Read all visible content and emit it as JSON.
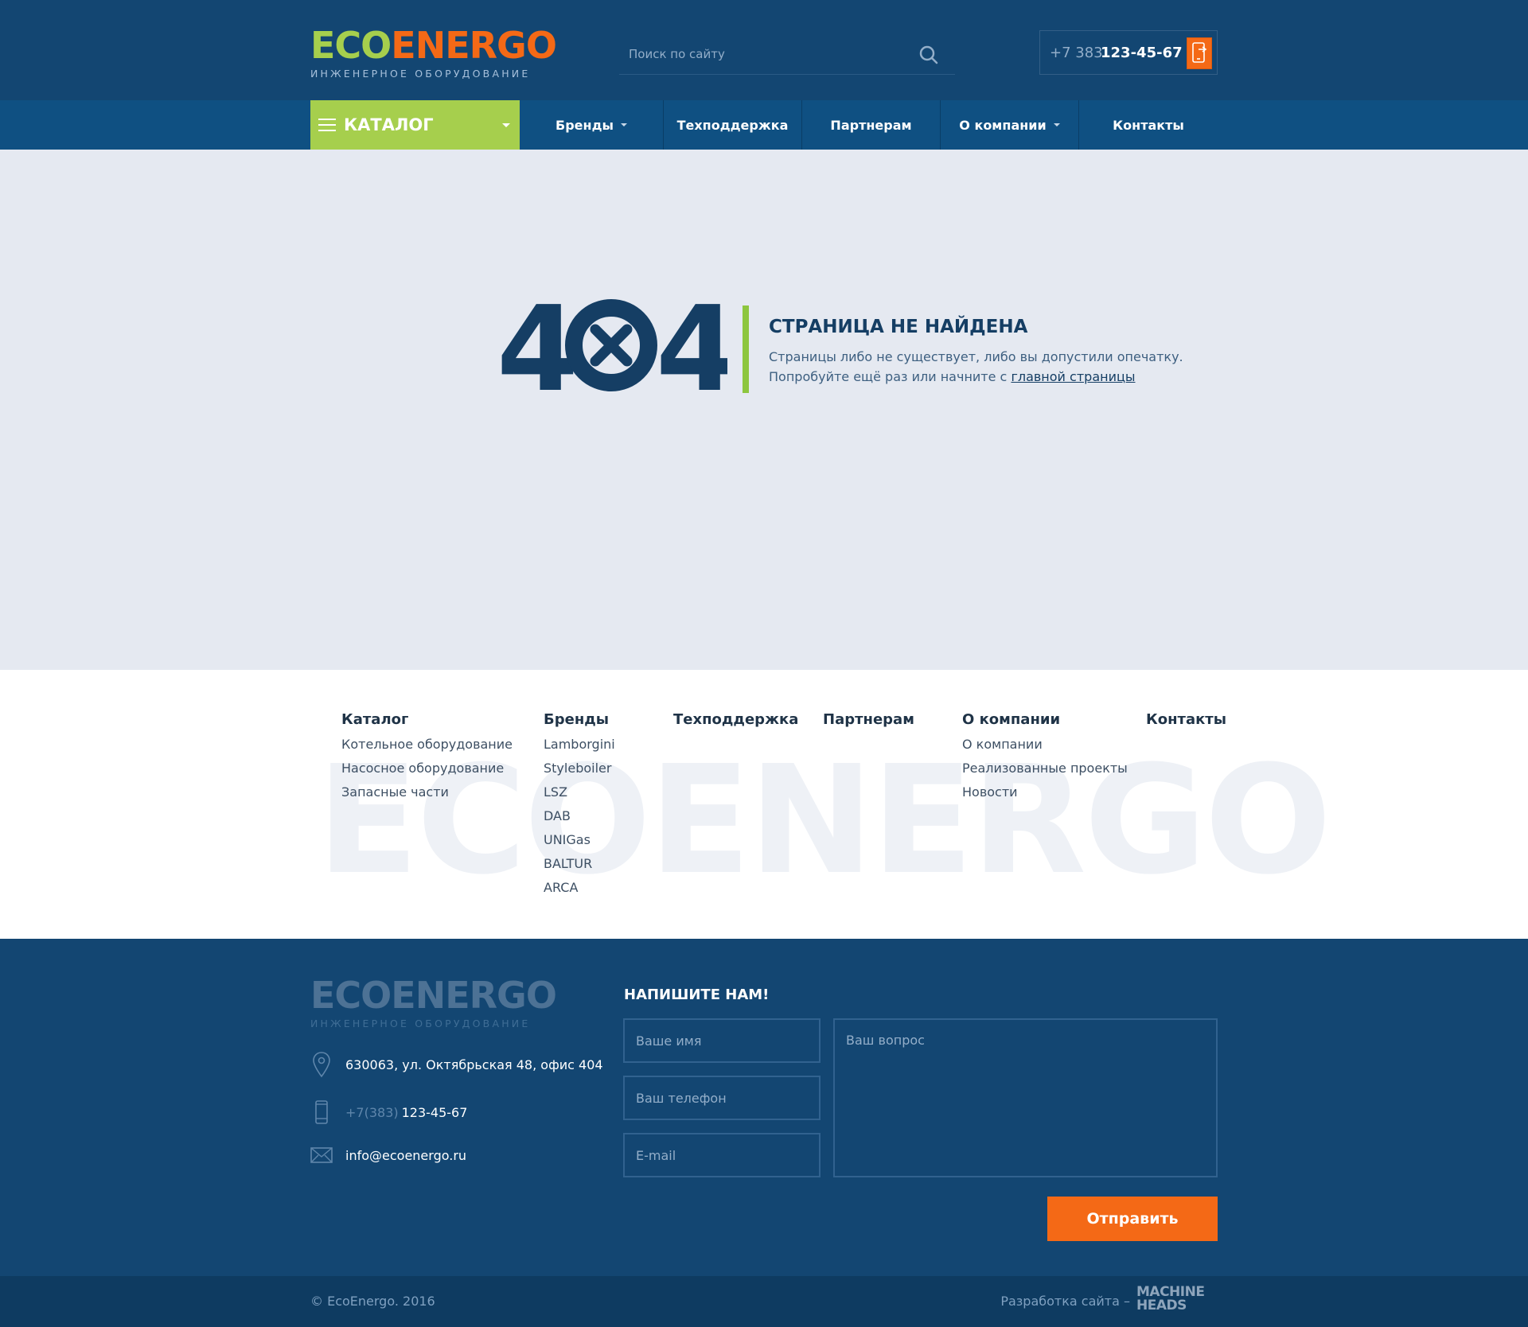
{
  "header": {
    "logo_eco": "ECO",
    "logo_energo": "ENERGO",
    "logo_subtitle": "ИНЖЕНЕРНОЕ ОБОРУДОВАНИЕ",
    "search_placeholder": "Поиск по сайту",
    "phone_code": "+7 383",
    "phone_number": "123-45-67"
  },
  "nav": {
    "catalog": "КАТАЛОГ",
    "items": [
      "Бренды",
      "Техподдержка",
      "Партнерам",
      "О компании",
      "Контакты"
    ]
  },
  "error": {
    "code": "404",
    "title": "СТРАНИЦА НЕ НАЙДЕНА",
    "line1": "Страницы либо не существует, либо вы допустили опечатку.",
    "line2_prefix": "Попробуйте ещё раз или начните с ",
    "line2_link": "главной страницы"
  },
  "footer_links": {
    "watermark": "ECOENERGO",
    "columns": [
      {
        "title": "Каталог",
        "links": [
          "Котельное оборудование",
          "Насосное оборудование",
          "Запасные части"
        ]
      },
      {
        "title": "Бренды",
        "links": [
          "Lamborgini",
          "Styleboiler",
          "LSZ",
          "DAB",
          "UNIGas",
          "BALTUR",
          "ARCA"
        ]
      },
      {
        "title": "Техподдержка",
        "links": []
      },
      {
        "title": "Партнерам",
        "links": []
      },
      {
        "title": "О компании",
        "links": [
          "О компании",
          "Реализованные проекты",
          "Новости"
        ]
      },
      {
        "title": "Контакты",
        "links": []
      }
    ]
  },
  "footer": {
    "address": "630063, ул. Октябрьская 48, офис 404",
    "phone_prefix": "+7(383)",
    "phone": "123-45-67",
    "email": "info@ecoenergo.ru",
    "form_title": "НАПИШИТЕ НАМ!",
    "name_placeholder": "Ваше имя",
    "phone_placeholder": "Ваш телефон",
    "email_placeholder": "E-mail",
    "question_placeholder": "Ваш вопрос",
    "submit": "Отправить"
  },
  "bottom": {
    "copyright": "© EcoEnergo. 2016",
    "dev_label": "Разработка сайта –",
    "dev_logo_line1": "MACHINE",
    "dev_logo_line2": "HEADS"
  },
  "colors": {
    "header_bg": "#134672",
    "nav_bg": "#0f5082",
    "accent_green": "#a6cf4d",
    "accent_orange": "#f46916",
    "body_bg": "#e5e9f1"
  }
}
